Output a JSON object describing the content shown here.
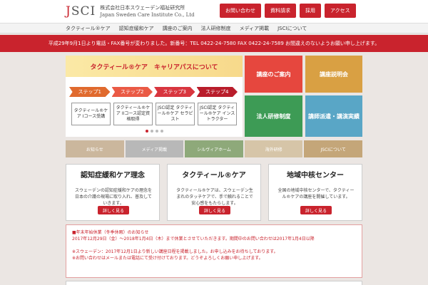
{
  "header": {
    "logo_mark_j": "J",
    "logo_mark_rest": "SCI",
    "company_ja": "株式会社日本スウェーデン福祉研究所",
    "company_en": "Japan Sweden Care Institute Co., Ltd",
    "top_buttons": [
      "お問い合わせ",
      "資料請求",
      "採用",
      "アクセス"
    ]
  },
  "nav": {
    "items": [
      "タクティール®ケア",
      "認知症緩和ケア",
      "講座のご案内",
      "法人研修制度",
      "メディア掲載",
      "JSCIについて"
    ]
  },
  "banner": {
    "text": "平成29年9月1日より電話・FAX番号が変わりました。新番号：TEL 0422-24-7580 FAX 0422-24-7589 お間違えのないようお願い申し上げます。"
  },
  "slider": {
    "title": "タクティール®ケア　キャリアパスについて",
    "steps": [
      "ステップ1",
      "ステップ2",
      "ステップ3",
      "ステップ4"
    ],
    "cards": [
      "タクティール®ケア Iコース受講",
      "タクティール®ケア IIコース認定資格取得",
      "JSCI認定 タクティール®ケア セラピスト",
      "JSCI認定 タクティール®ケア インストラクター"
    ]
  },
  "tiles": {
    "t1": "講座のご案内",
    "t2": "講座説明会",
    "t3": "法人研修制度",
    "t4": "講師派遣・講演実績"
  },
  "strip": [
    "お知らせ",
    "メディア掲載",
    "シルヴィアホーム",
    "海外研修",
    "JSCIについて"
  ],
  "boxes": [
    {
      "title": "認知症緩和ケア理念",
      "text": "スウェーデンの認知症緩和ケアの理念を日本の介護の現場に取り入れ、普及していきます。",
      "button": "詳しく見る"
    },
    {
      "title": "タクティール®ケア",
      "text": "タクティール®ケアは、スウェーデン生まれのタッチケアで、手で触れることで安心感をもたらします。",
      "button": "詳しく見る"
    },
    {
      "title": "地域中核センター",
      "text": "全国の地域中核センターで、タクティール®ケアの講座を開催しています。",
      "button": "詳しく見る"
    }
  ],
  "notice": {
    "lines": [
      "■年末年始休業（冬季休暇）のお知らせ",
      "2017年12月29日（金）〜2018年1月4日（木）まで休業とさせていただきます。期間中のお問い合わせは2017年1月4日以降",
      "",
      "※スウェーデン：2017年12月1日より新しい講座日程を掲載しました。お申し込みをお待ちしております。",
      "※お問い合わせはメールまたは電話にて受け付けております。どうぞよろしくお願い申し上げます。"
    ]
  }
}
